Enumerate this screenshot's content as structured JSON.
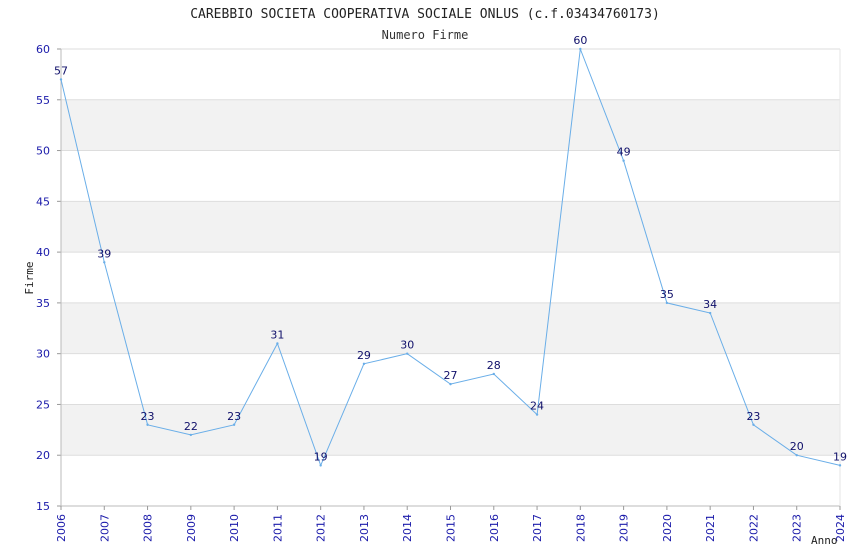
{
  "chart_data": {
    "type": "line",
    "title": "CAREBBIO SOCIETA COOPERATIVA SOCIALE ONLUS (c.f.03434760173)",
    "subtitle": "Numero Firme",
    "xlabel": "Anno",
    "ylabel": "Firme",
    "x": [
      "2006",
      "2007",
      "2008",
      "2009",
      "2010",
      "2011",
      "2012",
      "2013",
      "2014",
      "2015",
      "2016",
      "2017",
      "2018",
      "2019",
      "2020",
      "2021",
      "2022",
      "2023",
      "2024"
    ],
    "series": [
      {
        "values": [
          57,
          39,
          23,
          22,
          23,
          31,
          19,
          29,
          30,
          27,
          28,
          24,
          60,
          49,
          35,
          34,
          23,
          20,
          19
        ]
      }
    ],
    "ylim": [
      15,
      60
    ],
    "yticks": [
      15,
      20,
      25,
      30,
      35,
      40,
      45,
      50,
      55,
      60
    ],
    "grid": true,
    "colors": {
      "line": "#6aaee8",
      "band": "#f2f2f2",
      "grid": "#dddddd",
      "tick_text": "#1a1aaa",
      "label_text": "#10106a"
    }
  }
}
